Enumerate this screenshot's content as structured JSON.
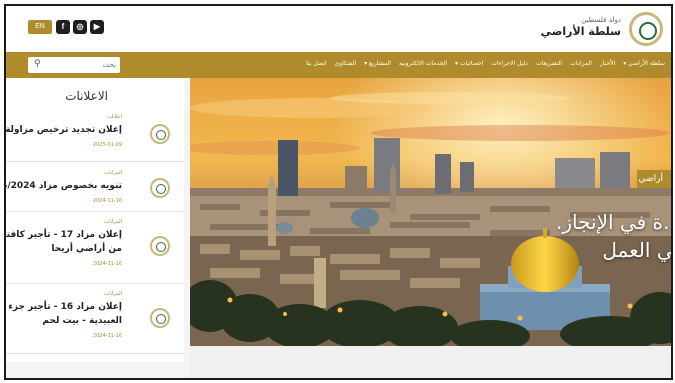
{
  "header": {
    "lang_button": "EN",
    "social": [
      {
        "icon": "facebook-icon",
        "glyph": "f"
      },
      {
        "icon": "instagram-icon",
        "glyph": "◎"
      },
      {
        "icon": "youtube-icon",
        "glyph": "▶"
      }
    ],
    "logo_small": "دولة فلسطين",
    "logo_big": "سلطة الأراضي"
  },
  "nav": {
    "search_placeholder": "بحث",
    "items": [
      "سلطة الأراضي ▾",
      "الأخبار",
      "المزادات",
      "التشريعات",
      "دليل الاجراءات",
      "احصائيات ▾",
      "الخدمات الالكترونية",
      "المشاريع ▾",
      "الشكاوى",
      "اتصل بنا"
    ]
  },
  "announcements": {
    "title": "الاعلانات",
    "items": [
      {
        "category": "اعلانات",
        "text": "إعلان تجديد ترخيص مزاولة مهنة",
        "date": "2025-01-09"
      },
      {
        "category": "المزادات",
        "text": "تنويه بخصوص مزاد 14/2024",
        "date": "2024-11-16"
      },
      {
        "category": "المزادات",
        "text": "إعلان مزاد 17 - تأجير كافتيريا (33009) من أراضي أريحا",
        "date": "2024-11-16"
      },
      {
        "category": "المزادات",
        "text": "إعلان مزاد 16 - تأجير جزء من أراضي العبيدية - بيت لحم",
        "date": "2024-11-16"
      }
    ]
  },
  "hero": {
    "tag": "أراضي",
    "title_line1": "…ة في الإنجاز.",
    "title_line2": "في العمل"
  },
  "colors": {
    "accent": "#b08b2b",
    "dark": "#1f1f1f"
  }
}
